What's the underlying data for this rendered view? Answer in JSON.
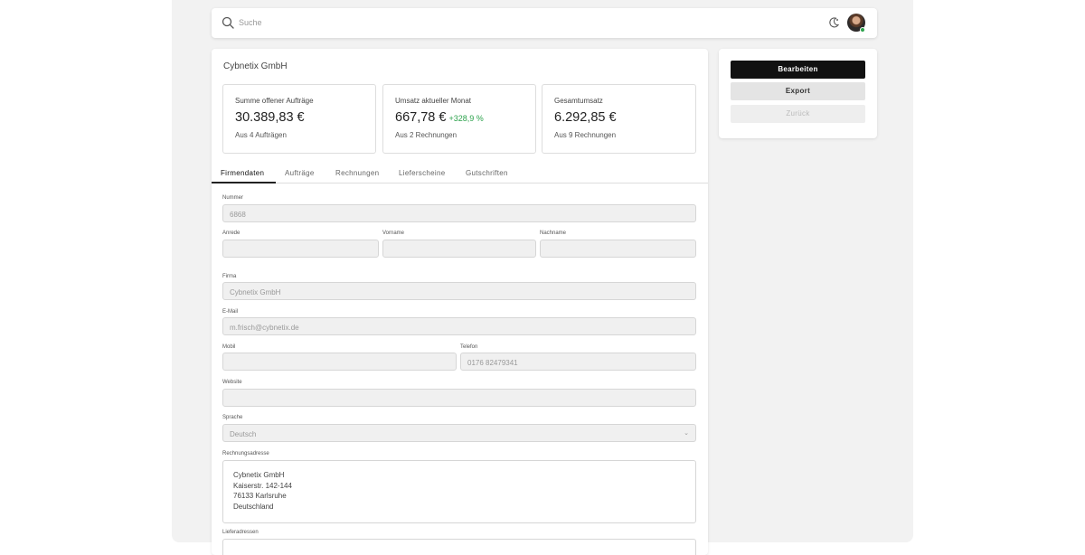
{
  "search": {
    "placeholder": "Suche"
  },
  "header": {
    "theme_icon": "moon-icon",
    "avatar": "user-avatar"
  },
  "company": {
    "title": "Cybnetix GmbH"
  },
  "stats": [
    {
      "label": "Summe offener Aufträge",
      "value": "30.389,83 €",
      "change": "",
      "sub": "Aus 4 Aufträgen"
    },
    {
      "label": "Umsatz aktueller Monat",
      "value": "667,78 €",
      "change": "+328,9 %",
      "sub": "Aus 2 Rechnungen"
    },
    {
      "label": "Gesamtumsatz",
      "value": "6.292,85 €",
      "change": "",
      "sub": "Aus 9 Rechnungen"
    }
  ],
  "tabs": [
    "Firmendaten",
    "Aufträge",
    "Rechnungen",
    "Lieferscheine",
    "Gutschriften"
  ],
  "active_tab": "Firmendaten",
  "form": {
    "nummer": {
      "label": "Nummer",
      "value": "6868"
    },
    "anrede": {
      "label": "Anrede",
      "value": ""
    },
    "vorname": {
      "label": "Vorname",
      "value": ""
    },
    "nachname": {
      "label": "Nachname",
      "value": ""
    },
    "firma": {
      "label": "Firma",
      "value": "Cybnetix GmbH"
    },
    "email": {
      "label": "E-Mail",
      "value": "m.frisch@cybnetix.de"
    },
    "mobil": {
      "label": "Mobil",
      "value": ""
    },
    "telefon": {
      "label": "Telefon",
      "value": "0176 82479341"
    },
    "website": {
      "label": "Website",
      "value": ""
    },
    "sprache": {
      "label": "Sprache",
      "value": "Deutsch"
    },
    "rechnungsadresse": {
      "label": "Rechnungsadresse",
      "lines": [
        "Cybnetix GmbH",
        "Kaiserstr. 142-144",
        "76133 Karlsruhe",
        "Deutschland"
      ]
    },
    "lieferadressen": {
      "label": "Lieferadressen"
    }
  },
  "actions": {
    "edit": "Bearbeiten",
    "export": "Export",
    "back": "Zurück"
  },
  "colors": {
    "positive": "#2ca24c",
    "primary_button": "#111111",
    "status_online": "#2ca24c"
  }
}
